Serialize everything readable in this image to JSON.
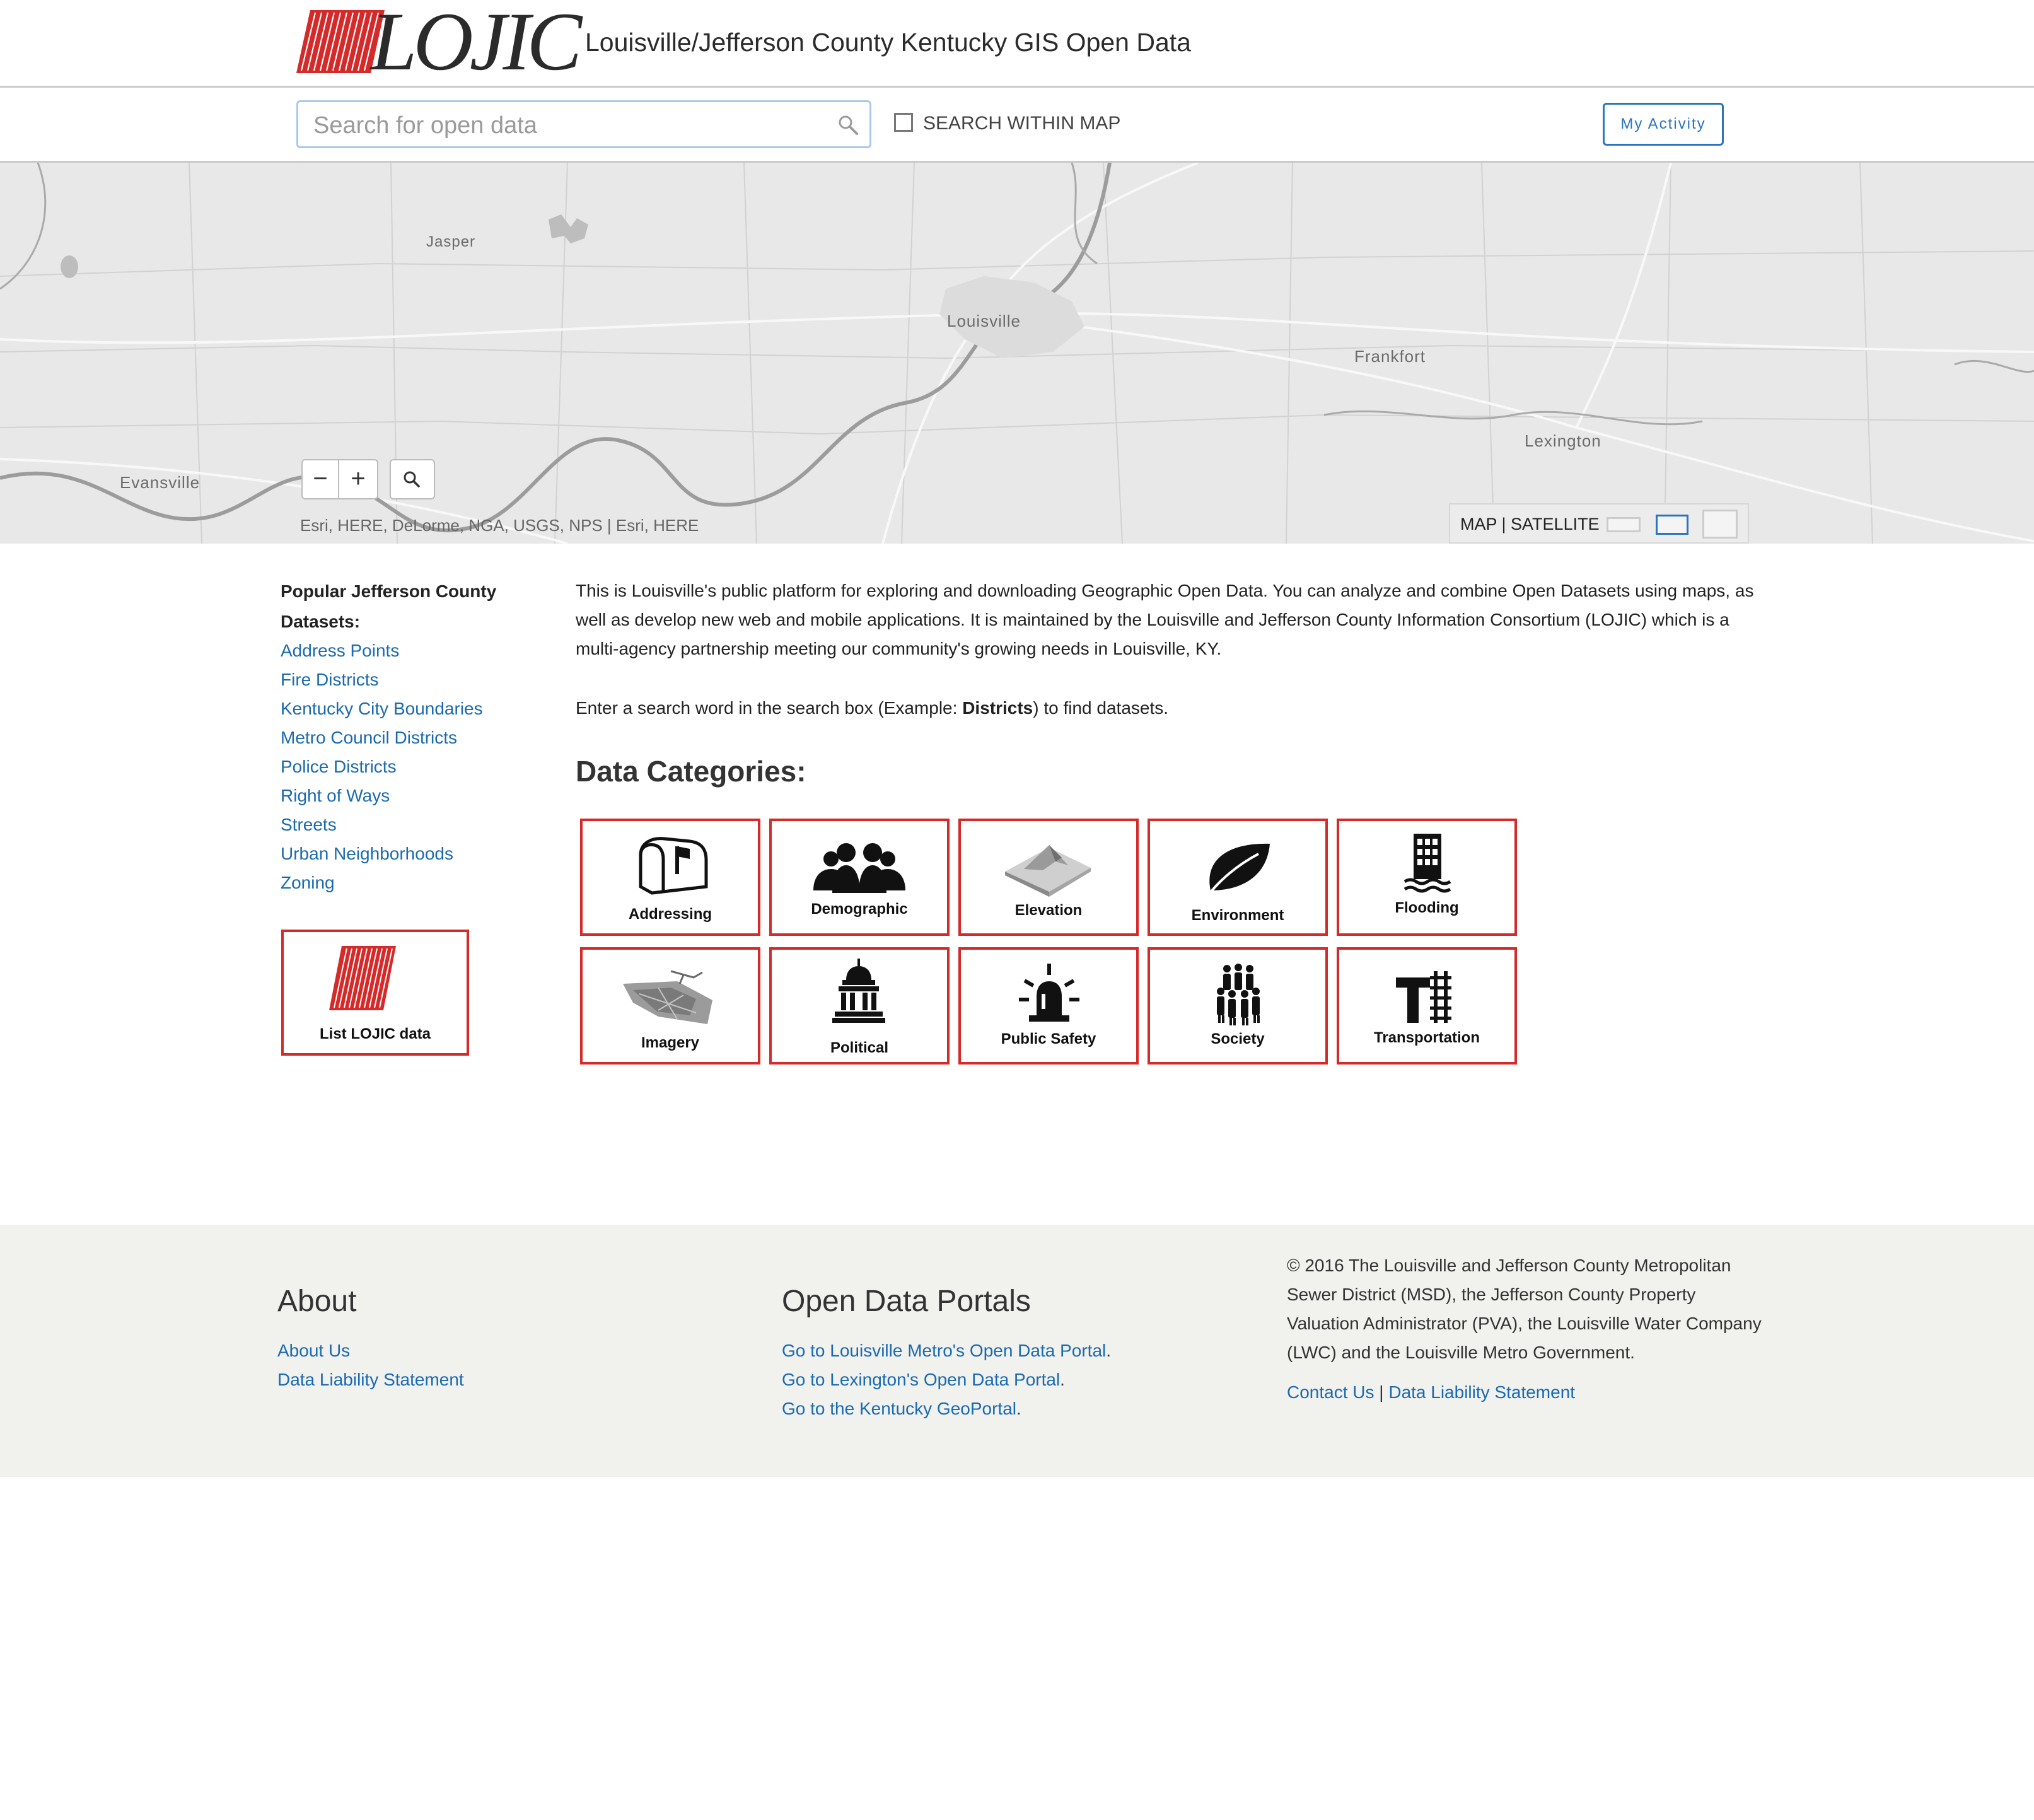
{
  "header": {
    "logo_text": "LOJIC",
    "site_title": "Louisville/Jefferson County Kentucky GIS Open Data"
  },
  "search": {
    "placeholder": "Search for open data",
    "value": "",
    "within_map_label": "SEARCH WITHIN MAP",
    "within_map_checked": false,
    "my_activity_label": "My Activity"
  },
  "map": {
    "cities": [
      "Jasper",
      "Louisville",
      "Frankfort",
      "Lexington",
      "Evansville"
    ],
    "zoom_out": "−",
    "zoom_in": "+",
    "attribution": "Esri, HERE, DeLorme, NGA, USGS, NPS |  Esri, HERE",
    "basemap_label": "MAP | SATELLITE"
  },
  "sidebar": {
    "title": "Popular Jefferson County Datasets:",
    "links": [
      "Address Points",
      "Fire Districts",
      "Kentucky City Boundaries",
      "Metro Council Districts",
      "Police Districts",
      "Right of Ways",
      "Streets",
      "Urban Neighborhoods",
      "Zoning"
    ],
    "list_lojic_label": "List LOJIC data"
  },
  "main": {
    "intro": "This is Louisville's public platform for exploring and downloading Geographic Open Data. You can analyze and combine Open Datasets using maps, as well as develop new web and mobile applications. It is maintained by the Louisville and Jefferson County Information Consortium (LOJIC) which is a multi-agency partnership meeting our community's growing needs in Louisville, KY.",
    "search_hint_before": "Enter a search word in the search box (Example: ",
    "search_hint_bold": "Districts",
    "search_hint_after": ") to find datasets.",
    "categories_title": "Data Categories:",
    "categories": [
      {
        "label": "Addressing",
        "icon": "mailbox-icon"
      },
      {
        "label": "Demographic",
        "icon": "people-group-icon"
      },
      {
        "label": "Elevation",
        "icon": "terrain-icon"
      },
      {
        "label": "Environment",
        "icon": "leaf-icon"
      },
      {
        "label": "Flooding",
        "icon": "flooded-building-icon"
      },
      {
        "label": "Imagery",
        "icon": "aerial-image-icon"
      },
      {
        "label": "Political",
        "icon": "capitol-icon"
      },
      {
        "label": "Public Safety",
        "icon": "siren-icon"
      },
      {
        "label": "Society",
        "icon": "crowd-icon"
      },
      {
        "label": "Transportation",
        "icon": "road-rail-icon"
      }
    ]
  },
  "footer": {
    "about_heading": "About",
    "about_links": [
      "About Us",
      "Data Liability Statement"
    ],
    "portals_heading": "Open Data Portals",
    "portal_links": [
      "Go to Louisville Metro's Open Data Portal",
      "Go to Lexington's Open Data Portal",
      "Go to the Kentucky GeoPortal"
    ],
    "copyright": "© 2016 The Louisville and Jefferson County Metropolitan Sewer District (MSD), the Jefferson County Property Valuation Administrator (PVA), the Louisville Water Company (LWC) and the Louisville Metro Government.",
    "contact_link": "Contact Us",
    "separator": "|",
    "liability_link": "Data Liability Statement"
  },
  "colors": {
    "brand_red": "#d42a2a",
    "link_blue": "#1a6ab0",
    "footer_bg": "#f1f1ee",
    "map_bg": "#e8e8e8"
  }
}
